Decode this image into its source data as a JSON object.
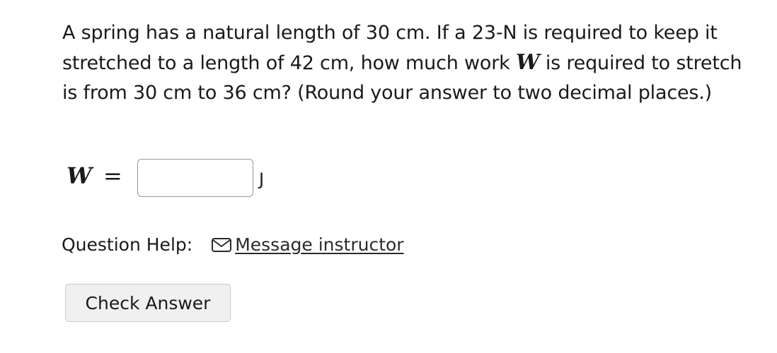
{
  "question": {
    "part1": "A spring has a natural length of 30 cm. If a 23-N is required to keep it stretched to a length of 42 cm, how much work ",
    "var": "W",
    "part2": " is required to stretch is from 30 cm to 36 cm? (Round your answer to two decimal places.)"
  },
  "answer": {
    "var": "W",
    "equals": "=",
    "value": "",
    "unit": "J"
  },
  "help": {
    "label": "Question Help:",
    "icon": "envelope-icon",
    "link_text": "Message instructor"
  },
  "check_button": {
    "label": "Check Answer"
  }
}
